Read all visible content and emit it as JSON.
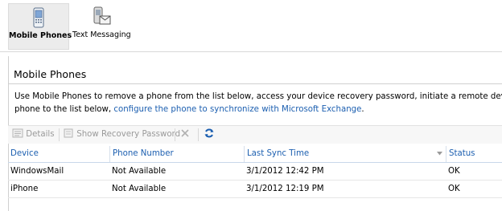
{
  "tabs": [
    {
      "label": "Mobile Phones",
      "icon": "mobile-phone-icon",
      "active": true
    },
    {
      "label": "Text Messaging",
      "icon": "text-messaging-icon",
      "active": false
    }
  ],
  "section": {
    "title": "Mobile Phones",
    "description_line1": "Use Mobile Phones to remove a phone from the list below, access your device recovery password, initiate a remote device wipe or",
    "description_line2_prefix": "phone to the list below, ",
    "description_link": "configure the phone to synchronize with Microsoft Exchange",
    "description_line2_suffix": "."
  },
  "toolbar": {
    "details_label": "Details",
    "show_recovery_label": "Show Recovery Password",
    "delete_icon": "delete-x-icon",
    "refresh_icon": "refresh-icon"
  },
  "table": {
    "columns": [
      "Device",
      "Phone Number",
      "Last Sync Time",
      "Status"
    ],
    "sorted_column": "Last Sync Time",
    "rows": [
      {
        "device": "WindowsMail",
        "phone": "Not Available",
        "sync": "3/1/2012 12:42 PM",
        "status": "OK"
      },
      {
        "device": "iPhone",
        "phone": "Not Available",
        "sync": "3/1/2012 12:19 PM",
        "status": "OK"
      }
    ]
  },
  "colors": {
    "accent": "#1c5fb0",
    "disabled_text": "#9a9a9a",
    "active_tab_bg": "#ececec"
  }
}
